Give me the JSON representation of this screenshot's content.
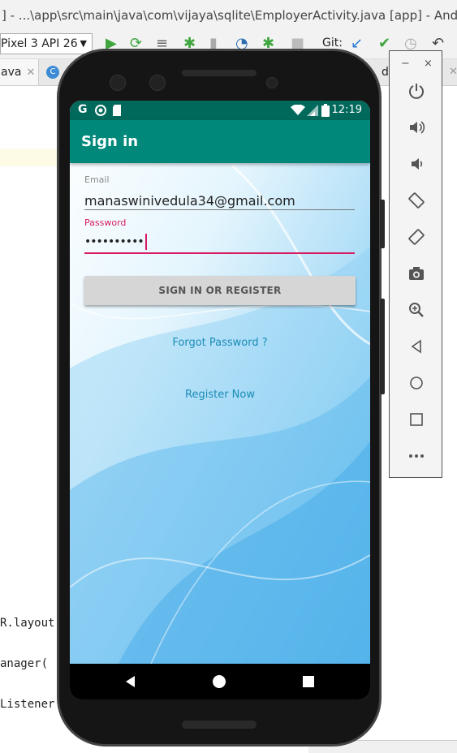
{
  "ide": {
    "title": "] - ...\\app\\src\\main\\java\\com\\vijaya\\sqlite\\EmployerActivity.java [app] - Android Studio",
    "device_selector": "Pixel 3 API 26",
    "git_label": "Git:",
    "open_tab": "ava",
    "right_tab": "d",
    "code_lines": [
      "R.layout",
      "anager(",
      "Listener"
    ]
  },
  "emulator_panel": {
    "minimize": "−",
    "close": "×",
    "buttons": [
      "power-icon",
      "volume-up-icon",
      "volume-down-icon",
      "rotate-left-icon",
      "rotate-right-icon",
      "camera-icon",
      "zoom-icon",
      "back-icon",
      "home-icon",
      "overview-icon",
      "more-icon"
    ]
  },
  "status_bar": {
    "left_icons": "G",
    "time": "12:19"
  },
  "app_bar": {
    "title": "Sign in"
  },
  "form": {
    "email_label": "Email",
    "email_value": "manaswinivedula34@gmail.com",
    "password_label": "Password",
    "password_value": "••••••••••",
    "submit_label": "SIGN IN OR REGISTER",
    "forgot_link": "Forgot Password ?",
    "register_link": "Register Now"
  },
  "colors": {
    "status_bar": "#00695c",
    "app_bar": "#00897b",
    "accent": "#d81b60",
    "link": "#1a8bb7"
  }
}
